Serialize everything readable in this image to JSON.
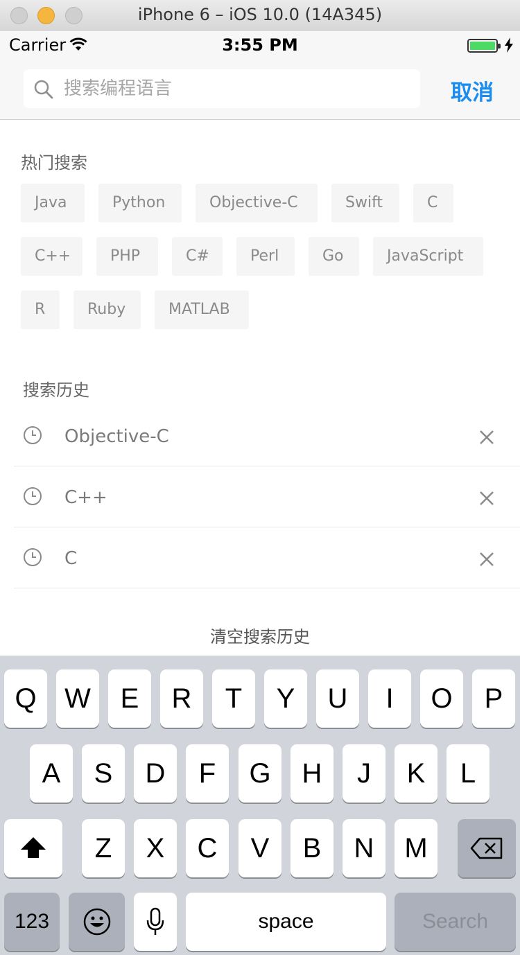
{
  "window": {
    "title": "iPhone 6 – iOS 10.0 (14A345)"
  },
  "status_bar": {
    "carrier": "Carrier",
    "time": "3:55 PM"
  },
  "search": {
    "placeholder": "搜索编程语言",
    "cancel_label": "取消"
  },
  "hot": {
    "title": "热门搜索",
    "tags": [
      "Java",
      "Python",
      "Objective-C",
      "Swift",
      "C",
      "C++",
      "PHP",
      "C#",
      "Perl",
      "Go",
      "JavaScript",
      "R",
      "Ruby",
      "MATLAB"
    ]
  },
  "history": {
    "title": "搜索历史",
    "items": [
      "Objective-C",
      "C++",
      "C"
    ],
    "clear_label": "清空搜索历史"
  },
  "keyboard": {
    "row1": [
      "Q",
      "W",
      "E",
      "R",
      "T",
      "Y",
      "U",
      "I",
      "O",
      "P"
    ],
    "row2": [
      "A",
      "S",
      "D",
      "F",
      "G",
      "H",
      "J",
      "K",
      "L"
    ],
    "row3": [
      "Z",
      "X",
      "C",
      "V",
      "B",
      "N",
      "M"
    ],
    "numbers_label": "123",
    "space_label": "space",
    "search_label": "Search"
  },
  "colors": {
    "accent": "#1a8cf0",
    "battery": "#4cd964",
    "keyboard_bg": "#d1d4da"
  }
}
